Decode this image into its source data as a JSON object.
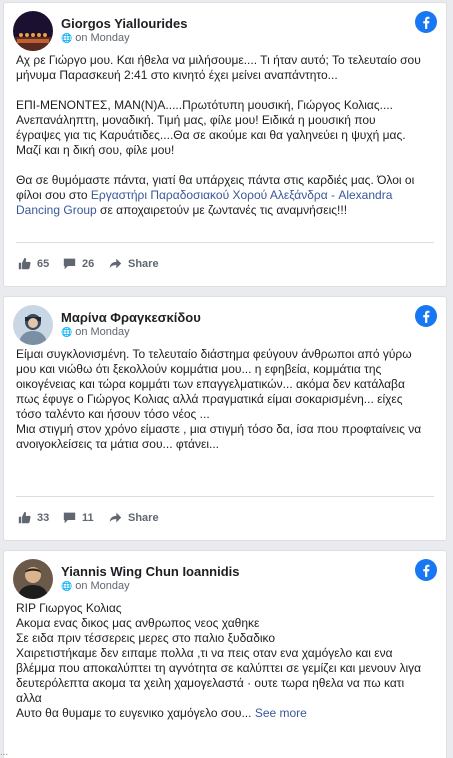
{
  "posts": [
    {
      "author": "Giorgos Yiallourides",
      "date": "on Monday",
      "lines": [
        "Αχ ρε Γιώργο μου. Και ήθελα να μιλήσουμε.... Τι ήταν αυτό; Το τελευταίο σου",
        "μήνυμα Παρασκευή 2:41 στο κινητό έχει μείνει αναπάντητο..."
      ],
      "lines2": [
        "ΕΠΙ-ΜΕΝΟΝΤΕΣ, ΜΑΝ(Ν)Α.....Πρωτότυπη μουσική, Γιώργος Κολιας....",
        "Ανεπανάληπτη, μοναδική. Τιμή μας, φίλε μου! Ειδικά η μουσική που",
        "έγραψες για τις Καρυάτιδες....Θα σε ακούμε και θα γαληνεύει η ψυχή μας.",
        "Μαζί και η δική σου, φίλε μου!"
      ],
      "lines3_a": "Θα σε θυμόμαστε πάντα, γιατί θα υπάρχεις πάντα στις καρδιές μας. Όλοι οι",
      "lines3_b": "φίλοι σου στο ",
      "lines3_link": "Εργαστήρι Παραδοσιακού Χορού Αλεξάνδρα - Alexandra",
      "lines3_link2": "Dancing Group",
      "lines3_c": " σε αποχαιρετούν με ζωντανές τις αναμνήσεις!!!",
      "likes": "65",
      "comments": "26",
      "share": "Share"
    },
    {
      "author": "Μαρίνα Φραγκεσκίδου",
      "date": "on Monday",
      "lines": [
        "Είμαι συγκλονισμένη. Το τελευταίο διάστημα φεύγουν άνθρωποι από γύρω",
        "μου και νιώθω ότι ξεκολλούν κομμάτια μου... η εφηβεία, κομμάτια της",
        "οικογένειας και τώρα κομμάτι των επαγγελματικών... ακόμα δεν κατάλαβα",
        "πως έφυγε ο Γιώργος Κολιας αλλά πραγματικά είμαι σοκαρισμένη... είχες",
        "τόσο ταλέντο και ήσουν τόσο νέος ...",
        "Μια στιγμή στον χρόνο είμαστε , μια στιγμή τόσο δα, ίσα που προφταίνεις να",
        "ανοιγοκλείσεις τα μάτια σου... φτάνει..."
      ],
      "likes": "33",
      "comments": "11",
      "share": "Share"
    },
    {
      "author": "Yiannis Wing Chun Ioannidis",
      "date": "on Monday",
      "lines": [
        "RIP Γιωργος Κολιας",
        "Ακομα ενας δικος μας ανθρωπος νεος χαθηκε",
        "Σε ειδα πριν τέσσερεις μερες στο παλιο ξυδαδικο",
        "Χαιρετιστήκαμε δεν ειπαμε πολλα ,τι να πεις οταν ενα χαμόγελο και ενα",
        "βλέμμα που αποκαλύπτει τη αγνότητα σε καλύπτει σε γεμίζει και μενουν λιγα",
        "δευτερόλεπτα ακομα τα χειλη χαμογελαστά · ουτε τωρα ηθελα να πω κατι",
        "αλλα"
      ],
      "last_line": "Αυτο θα θυμαμε το ευγενικο χαμόγελο σου... ",
      "see_more": "See more"
    }
  ],
  "ellipsis": "..."
}
